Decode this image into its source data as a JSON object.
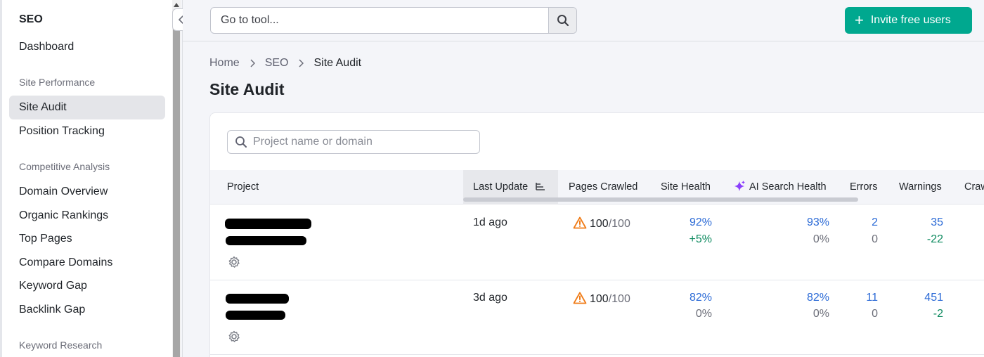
{
  "sidebar": {
    "title": "SEO",
    "items": [
      {
        "label": "Dashboard"
      },
      {
        "label": "Site Audit",
        "active": true
      },
      {
        "label": "Position Tracking"
      },
      {
        "label": "Domain Overview"
      },
      {
        "label": "Organic Rankings"
      },
      {
        "label": "Top Pages"
      },
      {
        "label": "Compare Domains"
      },
      {
        "label": "Keyword Gap"
      },
      {
        "label": "Backlink Gap"
      }
    ],
    "sections": [
      "Site Performance",
      "Competitive Analysis",
      "Keyword Research"
    ]
  },
  "topbar": {
    "search_placeholder": "Go to tool...",
    "invite_label": "Invite free users",
    "accent": "#00a88f"
  },
  "breadcrumb": [
    "Home",
    "SEO",
    "Site Audit"
  ],
  "page_title": "Site Audit",
  "table": {
    "search_placeholder": "Project name or domain",
    "columns": [
      "Project",
      "Last Update",
      "Pages Crawled",
      "Site Health",
      "AI Search Health",
      "Errors",
      "Warnings",
      "Craw"
    ],
    "rows": [
      {
        "last_update": "1d ago",
        "pages_done": "100",
        "pages_total": "/100",
        "site_health": "92%",
        "site_health_delta": "+5%",
        "ai_health": "93%",
        "ai_health_delta": "0%",
        "errors": "2",
        "errors_delta": "0",
        "warnings": "35",
        "warnings_delta": "-22"
      },
      {
        "last_update": "3d ago",
        "pages_done": "100",
        "pages_total": "/100",
        "site_health": "82%",
        "site_health_delta": "0%",
        "ai_health": "82%",
        "ai_health_delta": "0%",
        "errors": "11",
        "errors_delta": "0",
        "warnings": "451",
        "warnings_delta": "-2"
      }
    ]
  },
  "colors": {
    "link_blue": "#2b6ad6",
    "positive_green": "#0d8a5f",
    "warning_orange": "#f07b16",
    "ai_purple": "#8a3ffc"
  }
}
